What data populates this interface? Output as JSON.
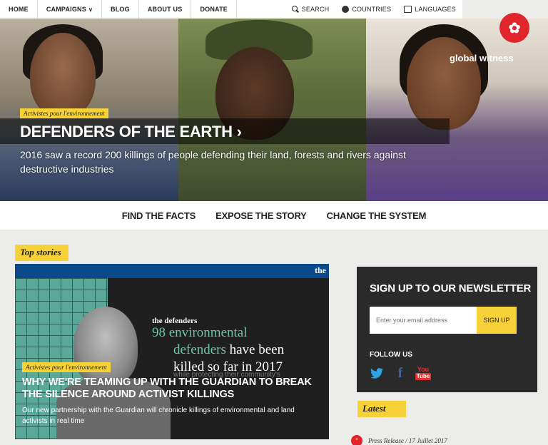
{
  "topnav": {
    "items": [
      "HOME",
      "CAMPAIGNS",
      "BLOG",
      "ABOUT US",
      "DONATE"
    ],
    "campaigns_chevron": "∨",
    "search": "SEARCH",
    "countries": "COUNTRIES",
    "languages": "LANGUAGES"
  },
  "brand": {
    "name": "global witness",
    "logo_glyph": "✿",
    "logo_color": "#e0262b"
  },
  "hero": {
    "tag": "Activistes pour l'environnement",
    "title": "DEFENDERS OF THE EARTH",
    "title_chevron": "›",
    "subtitle": "2016 saw a record 200 killings of people defending their land, forests and rivers against destructive industries"
  },
  "subnav": {
    "items": [
      "FIND THE FACTS",
      "EXPOSE THE STORY",
      "CHANGE THE SYSTEM"
    ]
  },
  "top_stories": {
    "label": "Top stories",
    "story": {
      "banner": "the",
      "graphic_small": "the defenders",
      "graphic_line1": "98 environmental",
      "graphic_line2a": "defenders ",
      "graphic_line2b": "have been",
      "graphic_line3": "killed so far in 2017",
      "graphic_line4": "while protecting their community's",
      "tag": "Activistes pour l'environnement",
      "title": "WHY WE'RE TEAMING UP WITH THE GUARDIAN TO BREAK THE SILENCE AROUND ACTIVIST KILLINGS",
      "subtitle": "Our new partnership with the Guardian will chronicle killings of environmental and land activists in real time"
    }
  },
  "newsletter": {
    "title": "SIGN UP TO OUR NEWSLETTER",
    "email_placeholder": "Enter your email address",
    "button": "SIGN UP",
    "follow": "FOLLOW US",
    "twitter_glyph": "🐦",
    "facebook_glyph": "f",
    "youtube_top": "You",
    "youtube_bottom": "Tube"
  },
  "latest": {
    "label": "Latest",
    "item_icon": "“",
    "item_text": "Press Release / 17 Juillet 2017"
  },
  "colors": {
    "accent_yellow": "#f7d138",
    "dark_panel": "#2a2a2a",
    "brand_red": "#e0262b"
  }
}
